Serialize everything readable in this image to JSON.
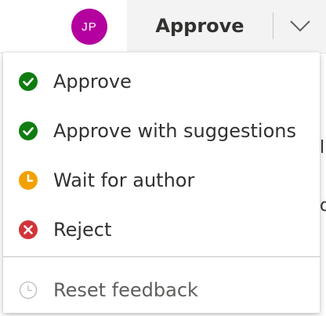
{
  "header": {
    "avatar_initials": "JP",
    "avatar_color": "#b4009e",
    "approve_label": "Approve",
    "dropdown_icon": "chevron-down-icon"
  },
  "menu": {
    "items": [
      {
        "label": "Approve",
        "icon": "check-circle-icon",
        "color": "#107c10"
      },
      {
        "label": "Approve with suggestions",
        "icon": "check-circle-icon",
        "color": "#107c10"
      },
      {
        "label": "Wait for author",
        "icon": "clock-icon",
        "color": "#f2a100"
      },
      {
        "label": "Reject",
        "icon": "x-circle-icon",
        "color": "#d13438"
      }
    ],
    "reset": {
      "label": "Reset feedback",
      "icon": "clock-outline-icon",
      "color": "#c8c6c4"
    }
  }
}
